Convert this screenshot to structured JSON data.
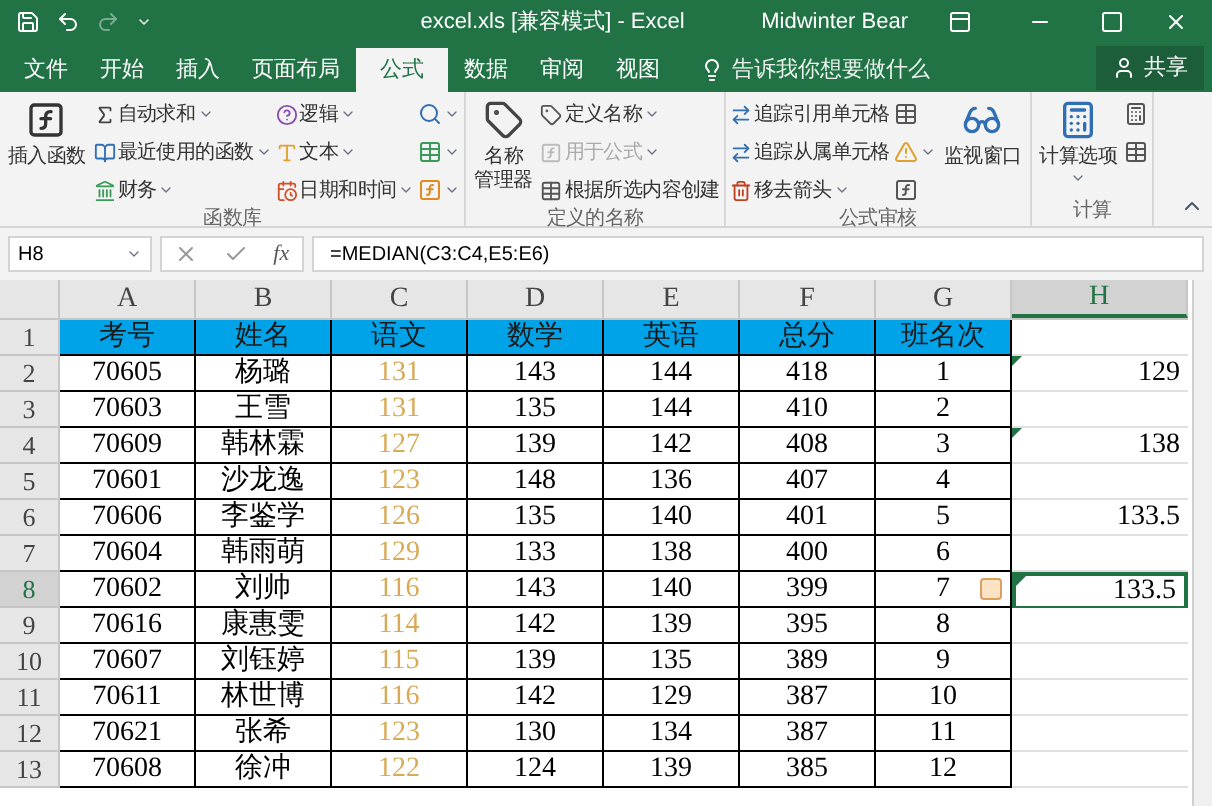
{
  "window": {
    "title": "excel.xls [兼容模式] - Excel",
    "user": "Midwinter Bear"
  },
  "tabs": [
    {
      "label": "文件",
      "selected": false
    },
    {
      "label": "开始",
      "selected": false
    },
    {
      "label": "插入",
      "selected": false
    },
    {
      "label": "页面布局",
      "selected": false
    },
    {
      "label": "公式",
      "selected": true
    },
    {
      "label": "数据",
      "selected": false
    },
    {
      "label": "审阅",
      "selected": false
    },
    {
      "label": "视图",
      "selected": false
    }
  ],
  "tell_me": {
    "placeholder": "告诉我你想要做什么"
  },
  "share": "共享",
  "ribbon": [
    {
      "label": "函数库",
      "columns": [
        [
          {
            "kind": "large",
            "lines": [
              "插入函数"
            ]
          }
        ],
        [
          {
            "kind": "small",
            "label": "自动求和",
            "dropdown": true,
            "disabled": false
          },
          {
            "kind": "small",
            "label": "最近使用的函数",
            "dropdown": true,
            "disabled": false
          },
          {
            "kind": "small",
            "label": "财务",
            "dropdown": true,
            "disabled": false
          }
        ],
        [
          {
            "kind": "small",
            "label": "逻辑",
            "dropdown": true,
            "disabled": false
          },
          {
            "kind": "small",
            "label": "文本",
            "dropdown": true,
            "disabled": false
          },
          {
            "kind": "small",
            "label": "日期和时间",
            "dropdown": true,
            "disabled": false
          }
        ],
        [
          {
            "kind": "icon",
            "dropdown": true
          },
          {
            "kind": "icon",
            "dropdown": true
          },
          {
            "kind": "icon",
            "dropdown": true
          }
        ]
      ]
    },
    {
      "label": "定义的名称",
      "columns": [
        [
          {
            "kind": "large",
            "lines": [
              "名称",
              "管理器"
            ]
          }
        ],
        [
          {
            "kind": "small",
            "label": "定义名称",
            "dropdown": true,
            "disabled": false
          },
          {
            "kind": "small",
            "label": "用于公式",
            "dropdown": true,
            "disabled": true
          },
          {
            "kind": "small",
            "label": "根据所选内容创建",
            "dropdown": false,
            "disabled": false
          }
        ]
      ]
    },
    {
      "label": "公式审核",
      "columns": [
        [
          {
            "kind": "small",
            "label": "追踪引用单元格",
            "dropdown": false,
            "disabled": false
          },
          {
            "kind": "small",
            "label": "追踪从属单元格",
            "dropdown": false,
            "disabled": false
          },
          {
            "kind": "small",
            "label": "移去箭头",
            "dropdown": true,
            "disabled": false
          }
        ],
        [
          {
            "kind": "icon",
            "dropdown": false
          },
          {
            "kind": "icon",
            "dropdown": true
          },
          {
            "kind": "icon",
            "dropdown": false
          }
        ],
        [
          {
            "kind": "large",
            "lines": [
              "监视窗口"
            ]
          }
        ]
      ]
    },
    {
      "label": "计算",
      "columns": [
        [
          {
            "kind": "large",
            "lines": [
              "计算选项"
            ],
            "dropdown": true
          }
        ],
        [
          {
            "kind": "icon",
            "dropdown": false
          },
          {
            "kind": "icon",
            "dropdown": false
          }
        ]
      ]
    }
  ],
  "formula_bar": {
    "name_box": "H8",
    "function_symbol": "fx",
    "formula": "=MEDIAN(C3:C4,E5:E6)"
  },
  "columns": [
    {
      "label": "A",
      "selected": false,
      "color": "#000000"
    },
    {
      "label": "B",
      "selected": false,
      "color": "#000000"
    },
    {
      "label": "C",
      "selected": false,
      "color": "#d9aa55"
    },
    {
      "label": "D",
      "selected": false,
      "color": "#000000"
    },
    {
      "label": "E",
      "selected": false,
      "color": "#000000"
    },
    {
      "label": "F",
      "selected": false,
      "color": "#000000"
    },
    {
      "label": "G",
      "selected": false,
      "color": "#000000"
    },
    {
      "label": "H",
      "selected": true,
      "color": "#000000"
    }
  ],
  "rows": [
    {
      "number": "1",
      "selected": false,
      "header": true,
      "cells": [
        "考号",
        "姓名",
        "语文",
        "数学",
        "英语",
        "总分",
        "班名次"
      ],
      "h": "",
      "h_flag": false,
      "paste_options": false
    },
    {
      "number": "2",
      "selected": false,
      "header": false,
      "cells": [
        "70605",
        "杨璐",
        "131",
        "143",
        "144",
        "418",
        "1"
      ],
      "h": "129",
      "h_flag": true,
      "paste_options": false
    },
    {
      "number": "3",
      "selected": false,
      "header": false,
      "cells": [
        "70603",
        "王雪",
        "131",
        "135",
        "144",
        "410",
        "2"
      ],
      "h": "",
      "h_flag": false,
      "paste_options": false
    },
    {
      "number": "4",
      "selected": false,
      "header": false,
      "cells": [
        "70609",
        "韩林霖",
        "127",
        "139",
        "142",
        "408",
        "3"
      ],
      "h": "138",
      "h_flag": true,
      "paste_options": false
    },
    {
      "number": "5",
      "selected": false,
      "header": false,
      "cells": [
        "70601",
        "沙龙逸",
        "123",
        "148",
        "136",
        "407",
        "4"
      ],
      "h": "",
      "h_flag": false,
      "paste_options": false
    },
    {
      "number": "6",
      "selected": false,
      "header": false,
      "cells": [
        "70606",
        "李鉴学",
        "126",
        "135",
        "140",
        "401",
        "5"
      ],
      "h": "133.5",
      "h_flag": false,
      "paste_options": false
    },
    {
      "number": "7",
      "selected": false,
      "header": false,
      "cells": [
        "70604",
        "韩雨萌",
        "129",
        "133",
        "138",
        "400",
        "6"
      ],
      "h": "",
      "h_flag": false,
      "paste_options": false
    },
    {
      "number": "8",
      "selected": true,
      "header": false,
      "cells": [
        "70602",
        "刘帅",
        "116",
        "143",
        "140",
        "399",
        "7"
      ],
      "h": "133.5",
      "h_flag": true,
      "paste_options": true
    },
    {
      "number": "9",
      "selected": false,
      "header": false,
      "cells": [
        "70616",
        "康惠雯",
        "114",
        "142",
        "139",
        "395",
        "8"
      ],
      "h": "",
      "h_flag": false,
      "paste_options": false
    },
    {
      "number": "10",
      "selected": false,
      "header": false,
      "cells": [
        "70607",
        "刘钰婷",
        "115",
        "139",
        "135",
        "389",
        "9"
      ],
      "h": "",
      "h_flag": false,
      "paste_options": false
    },
    {
      "number": "11",
      "selected": false,
      "header": false,
      "cells": [
        "70611",
        "林世博",
        "116",
        "142",
        "129",
        "387",
        "10"
      ],
      "h": "",
      "h_flag": false,
      "paste_options": false
    },
    {
      "number": "12",
      "selected": false,
      "header": false,
      "cells": [
        "70621",
        "张希",
        "123",
        "130",
        "134",
        "387",
        "11"
      ],
      "h": "",
      "h_flag": false,
      "paste_options": false
    },
    {
      "number": "13",
      "selected": false,
      "header": false,
      "cells": [
        "70608",
        "徐冲",
        "122",
        "124",
        "139",
        "385",
        "12"
      ],
      "h": "",
      "h_flag": false,
      "paste_options": false
    }
  ]
}
